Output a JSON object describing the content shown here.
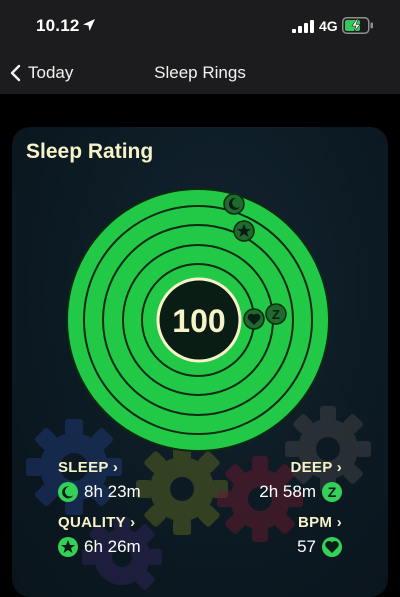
{
  "status_bar": {
    "time": "10.12",
    "network": "4G",
    "icons": [
      "location-arrow-icon",
      "signal-bars-icon",
      "battery-charging-icon"
    ]
  },
  "nav": {
    "back_label": "Today",
    "title": "Sleep Rings",
    "back_icon": "chevron-left-icon"
  },
  "card": {
    "title": "Sleep Rating",
    "score": "100",
    "ring_marker_icons": [
      "moon-icon",
      "star-icon",
      "heart-icon",
      "z-icon"
    ]
  },
  "stats": {
    "sleep": {
      "label": "SLEEP ›",
      "value": "8h 23m",
      "icon": "moon-icon"
    },
    "deep": {
      "label": "DEEP ›",
      "value": "2h 58m",
      "icon": "z-icon"
    },
    "quality": {
      "label": "QUALITY ›",
      "value": "6h 26m",
      "icon": "star-icon"
    },
    "bpm": {
      "label": "BPM ›",
      "value": "57",
      "icon": "heart-icon"
    }
  },
  "colors": {
    "ring_green": "#22c947",
    "ring_line": "#0d2a12",
    "title_cream": "#f6f3c9",
    "background": "#000000",
    "card": "#0f1e28"
  }
}
